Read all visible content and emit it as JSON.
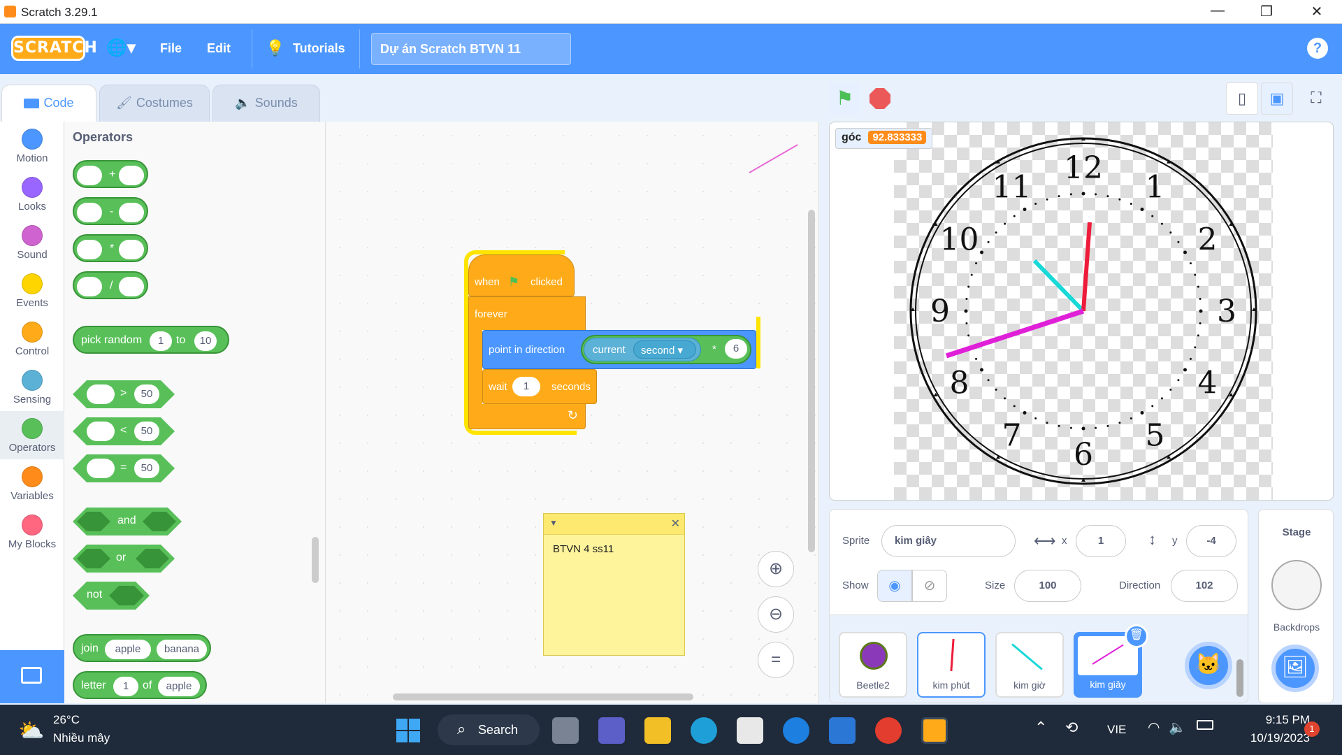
{
  "window": {
    "title": "Scratch 3.29.1",
    "min": "—",
    "max": "❐",
    "close": "✕"
  },
  "menu": {
    "logo": "SCRATCH",
    "globe": "🌐▾",
    "file": "File",
    "edit": "Edit",
    "tutorials": "Tutorials",
    "project_title": "Dự án Scratch BTVN 11",
    "help": "?"
  },
  "tabs": [
    {
      "label": "Code"
    },
    {
      "label": "Costumes"
    },
    {
      "label": "Sounds"
    }
  ],
  "categories": [
    {
      "label": "Motion",
      "color": "#4c97ff"
    },
    {
      "label": "Looks",
      "color": "#9966ff"
    },
    {
      "label": "Sound",
      "color": "#cf63cf"
    },
    {
      "label": "Events",
      "color": "#ffd500"
    },
    {
      "label": "Control",
      "color": "#ffab19"
    },
    {
      "label": "Sensing",
      "color": "#5cb1d6"
    },
    {
      "label": "Operators",
      "color": "#59c059"
    },
    {
      "label": "Variables",
      "color": "#ff8c1a"
    },
    {
      "label": "My Blocks",
      "color": "#ff6680"
    }
  ],
  "palette": {
    "heading": "Operators",
    "plus": "+",
    "minus": "-",
    "times": "*",
    "divide": "/",
    "pick_random": {
      "label": "pick random",
      "from": "1",
      "to_label": "to",
      "to": "10"
    },
    "gt": {
      "op": ">",
      "val": "50"
    },
    "lt": {
      "op": "<",
      "val": "50"
    },
    "eq": {
      "op": "=",
      "val": "50"
    },
    "and": "and",
    "or": "or",
    "not": "not",
    "join": {
      "label": "join",
      "a": "apple",
      "b": "banana"
    },
    "letter": {
      "label": "letter",
      "n": "1",
      "of": "of",
      "s": "apple"
    }
  },
  "script": {
    "when": "when",
    "clicked": "clicked",
    "forever": "forever",
    "point": "point in direction",
    "current": "current",
    "second": "second ▾",
    "times": "*",
    "mult": "6",
    "wait": "wait",
    "wait_val": "1",
    "seconds": "seconds"
  },
  "note": {
    "text": "BTVN 4 ss11"
  },
  "zoom": {
    "in": "⊕",
    "out": "⊖",
    "reset": "="
  },
  "stage": {
    "monitor_label": "góc",
    "monitor_value": "92.833333",
    "clock_numbers": [
      "12",
      "1",
      "2",
      "3",
      "4",
      "5",
      "6",
      "7",
      "8",
      "9",
      "10",
      "11"
    ]
  },
  "sprite_info": {
    "sprite_label": "Sprite",
    "sprite_name": "kim giây",
    "x_label": "x",
    "x": "1",
    "y_label": "y",
    "y": "-4",
    "show_label": "Show",
    "size_label": "Size",
    "size": "100",
    "direction_label": "Direction",
    "direction": "102"
  },
  "sprites": [
    {
      "name": "Beetle2"
    },
    {
      "name": "kim phút"
    },
    {
      "name": "kim giờ"
    },
    {
      "name": "kim giây"
    }
  ],
  "stage_panel": {
    "title": "Stage",
    "backdrops": "Backdrops"
  },
  "taskbar": {
    "temp": "26°C",
    "weather": "Nhiều mây",
    "search": "Search",
    "lang": "VIE",
    "time": "9:15 PM",
    "date": "10/19/2023",
    "notif": "1"
  },
  "colors": {
    "accent": "#4c97ff",
    "operators": "#59c059",
    "control": "#ffab19",
    "motion": "#4c97ff",
    "sensing": "#5cb1d6",
    "highlight": "#ffe400"
  }
}
